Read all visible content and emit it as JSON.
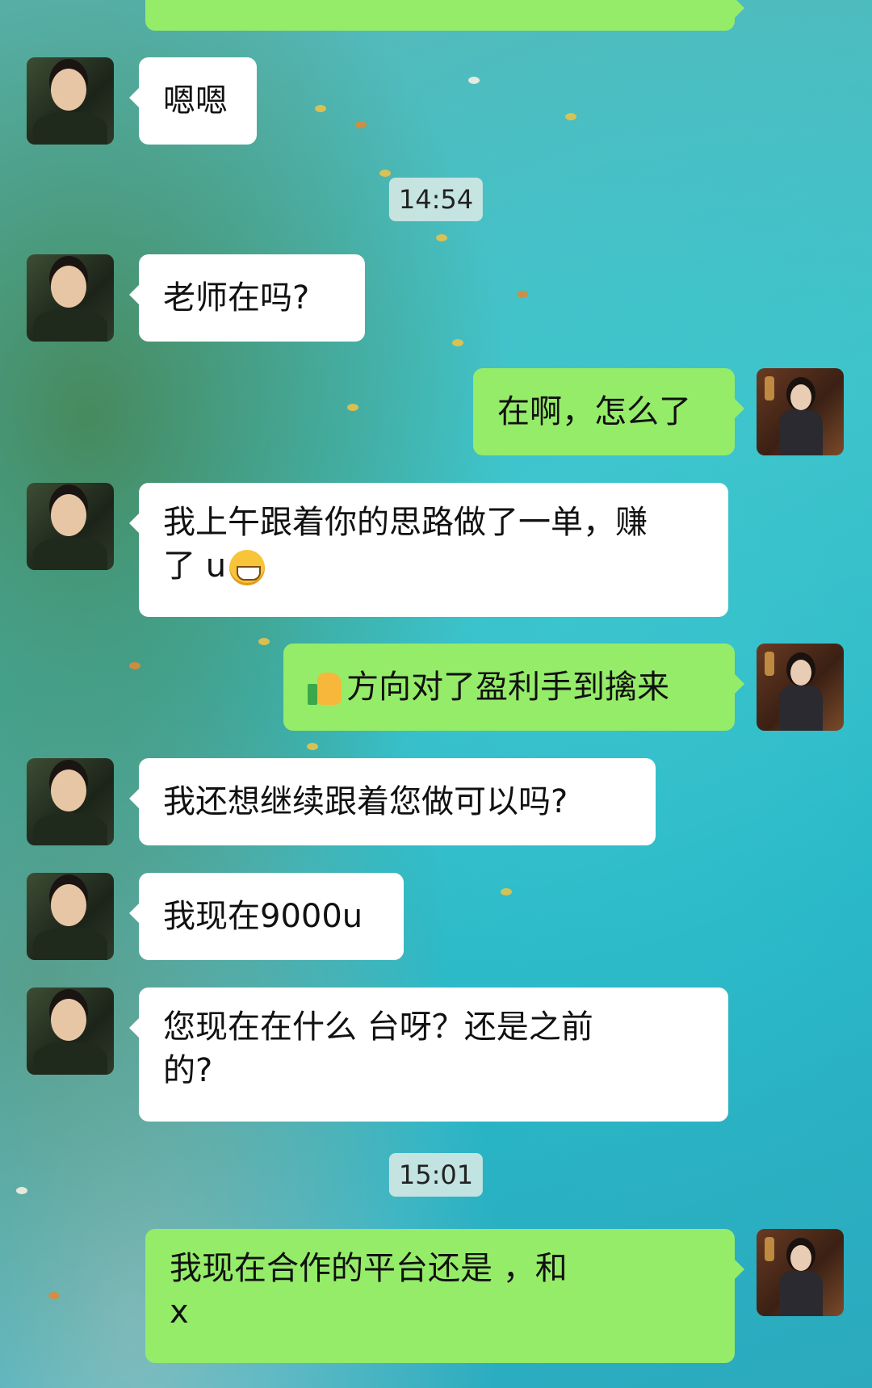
{
  "messages": [
    {
      "side": "left",
      "text": "嗯嗯"
    },
    {
      "side": "time",
      "text": "14:54"
    },
    {
      "side": "left",
      "text": "老师在吗?"
    },
    {
      "side": "right",
      "text": "在啊，怎么了"
    },
    {
      "side": "left",
      "line1": "我上午跟着你的思路做了一单，赚",
      "line2": "了  u",
      "emoji": "grinning-face-icon"
    },
    {
      "side": "right",
      "text": "方向对了盈利手到擒来",
      "emoji": "thumbs-up-icon"
    },
    {
      "side": "left",
      "text": "我还想继续跟着您做可以吗?"
    },
    {
      "side": "left",
      "text": "我现在9000u"
    },
    {
      "side": "left",
      "line1": "您现在在什么  台呀？还是之前",
      "line2": "的?"
    },
    {
      "side": "time",
      "text": "15:01"
    },
    {
      "side": "right",
      "line1": "我现在合作的平台还是  ，和",
      "line2": "   x"
    }
  ],
  "colors": {
    "outgoing_bubble": "#95ec69",
    "incoming_bubble": "#ffffff"
  }
}
